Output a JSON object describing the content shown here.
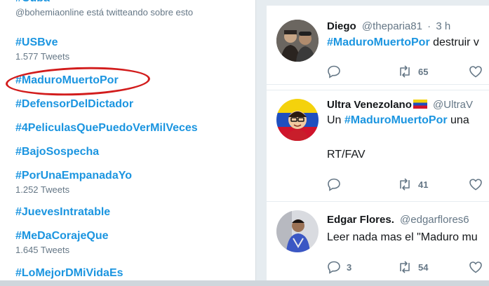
{
  "trends": [
    {
      "tag": "#Cuba",
      "sub": "@bohemiaonline está twitteando sobre esto"
    },
    {
      "tag": "#USBve",
      "sub": "1.577 Tweets"
    },
    {
      "tag": "#MaduroMuertoPor",
      "sub": ""
    },
    {
      "tag": "#DefensorDelDictador",
      "sub": ""
    },
    {
      "tag": "#4PeliculasQuePuedoVerMilVeces",
      "sub": ""
    },
    {
      "tag": "#BajoSospecha",
      "sub": ""
    },
    {
      "tag": "#PorUnaEmpanadaYo",
      "sub": "1.252 Tweets"
    },
    {
      "tag": "#JuevesIntratable",
      "sub": ""
    },
    {
      "tag": "#MeDaCorajeQue",
      "sub": "1.645 Tweets"
    },
    {
      "tag": "#LoMejorDMiVidaEs",
      "sub": ""
    }
  ],
  "highlight_color": "#d21c1c",
  "link_color": "#1b95e0",
  "tweets": [
    {
      "name": "Diego",
      "handle": "@theparia81",
      "time": "3 h",
      "hashtag": "#MaduroMuertoPor",
      "text": " destruir v",
      "extra": "",
      "reply_count": "",
      "retweet_count": "65",
      "like_count": ""
    },
    {
      "name": "Ultra Venezolano",
      "handle": "@UltraV",
      "time": "",
      "prefix": "Un ",
      "hashtag": "#MaduroMuertoPor",
      "text": " una",
      "extra": "RT/FAV",
      "reply_count": "",
      "retweet_count": "41",
      "like_count": ""
    },
    {
      "name": "Edgar Flores.",
      "handle": "@edgarflores6",
      "time": "",
      "text": "Leer nada mas el \"Maduro mu",
      "extra": "",
      "reply_count": "3",
      "retweet_count": "54",
      "like_count": "",
      "like_color": "#657786"
    }
  ],
  "icons": [
    "reply-icon",
    "retweet-icon",
    "like-icon",
    "venezuela-flag-icon"
  ]
}
